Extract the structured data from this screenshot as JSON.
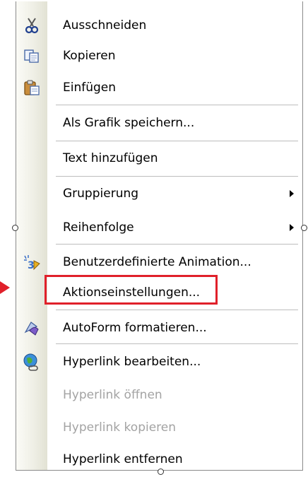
{
  "menu": {
    "items": [
      {
        "label": "Ausschneiden",
        "icon": "scissors-icon",
        "disabled": false
      },
      {
        "label": "Kopieren",
        "icon": "copy-icon",
        "disabled": false
      },
      {
        "label": "Einfügen",
        "icon": "paste-icon",
        "disabled": false
      },
      {
        "label": "Als Grafik speichern...",
        "disabled": false
      },
      {
        "label": "Text hinzufügen",
        "disabled": false
      },
      {
        "label": "Gruppierung",
        "disabled": false,
        "submenu": true
      },
      {
        "label": "Reihenfolge",
        "disabled": false,
        "submenu": true
      },
      {
        "label": "Benutzerdefinierte Animation...",
        "icon": "custom-animation-icon",
        "disabled": false
      },
      {
        "label": "Aktionseinstellungen...",
        "disabled": false,
        "highlighted": true
      },
      {
        "label": "AutoForm formatieren...",
        "icon": "format-autoshape-icon",
        "disabled": false
      },
      {
        "label": "Hyperlink bearbeiten...",
        "icon": "hyperlink-icon",
        "disabled": false
      },
      {
        "label": "Hyperlink öffnen",
        "disabled": true
      },
      {
        "label": "Hyperlink kopieren",
        "disabled": true
      },
      {
        "label": "Hyperlink entfernen",
        "disabled": false
      }
    ]
  },
  "colors": {
    "highlight": "#e0202a",
    "disabled_text": "#a3a3a3",
    "separator": "#bdbdbd"
  }
}
